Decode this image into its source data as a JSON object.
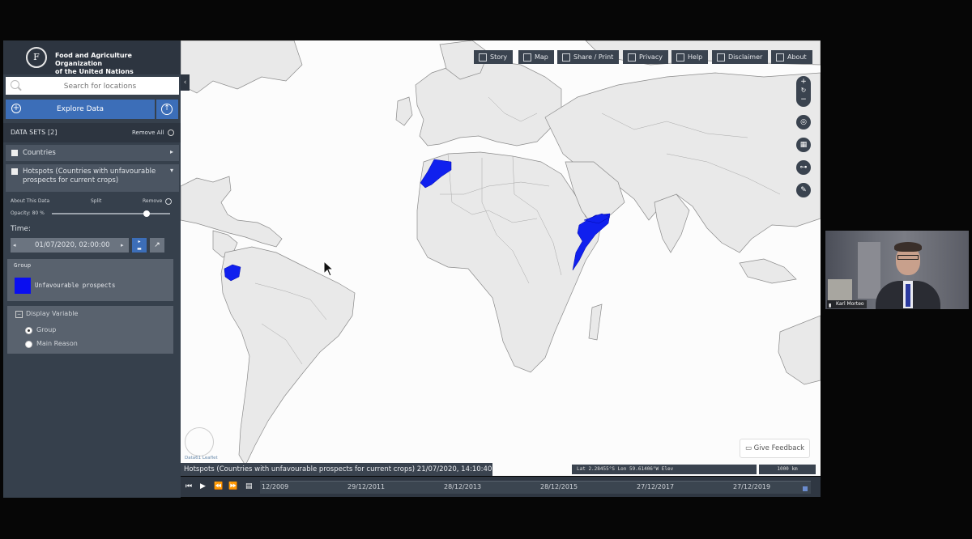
{
  "brand": {
    "org_line1": "Food and Agriculture Organization",
    "org_line2": "of the United Nations"
  },
  "search": {
    "placeholder": "Search for locations"
  },
  "explore": {
    "label": "Explore Data"
  },
  "datasets": {
    "header": "DATA SETS",
    "count": "[2]",
    "remove_all": "Remove All",
    "items": [
      {
        "label": "Countries"
      },
      {
        "label": "Hotspots (Countries with unfavourable prospects for current crops)"
      }
    ],
    "about_label": "About This Data",
    "split_label": "Split",
    "remove_label": "Remove",
    "opacity_label": "Opacity: 80 %",
    "opacity_value": 0.8
  },
  "time": {
    "label": "Time:",
    "value": "01/07/2020, 02:00:00"
  },
  "legend": {
    "title": "Group",
    "item_label": "Unfavourable prospects",
    "item_color": "#0a0ef0"
  },
  "display_variable": {
    "title": "Display Variable",
    "options": [
      {
        "label": "Group",
        "selected": true
      },
      {
        "label": "Main Reason",
        "selected": false
      }
    ]
  },
  "toolbar": {
    "story": "Story",
    "map": "Map",
    "share": "Share / Print",
    "privacy": "Privacy",
    "help": "Help",
    "disclaimer": "Disclaimer",
    "about": "About"
  },
  "map": {
    "feedback": "Give Feedback",
    "caption": "Hotspots (Countries with unfavourable prospects for current crops) 21/07/2020, 14:10:40",
    "coords": "Lat  2.28455°S    Lon  59.61406°W    Elev",
    "scale": "1000 km",
    "attribution": "Data61  Leaflet",
    "hotspot_color": "#1020ee"
  },
  "timeline": {
    "ticks": [
      "12/2009",
      "29/12/2011",
      "28/12/2013",
      "28/12/2015",
      "27/12/2017",
      "27/12/2019"
    ]
  },
  "webcam": {
    "name": "Karl Morteo"
  }
}
